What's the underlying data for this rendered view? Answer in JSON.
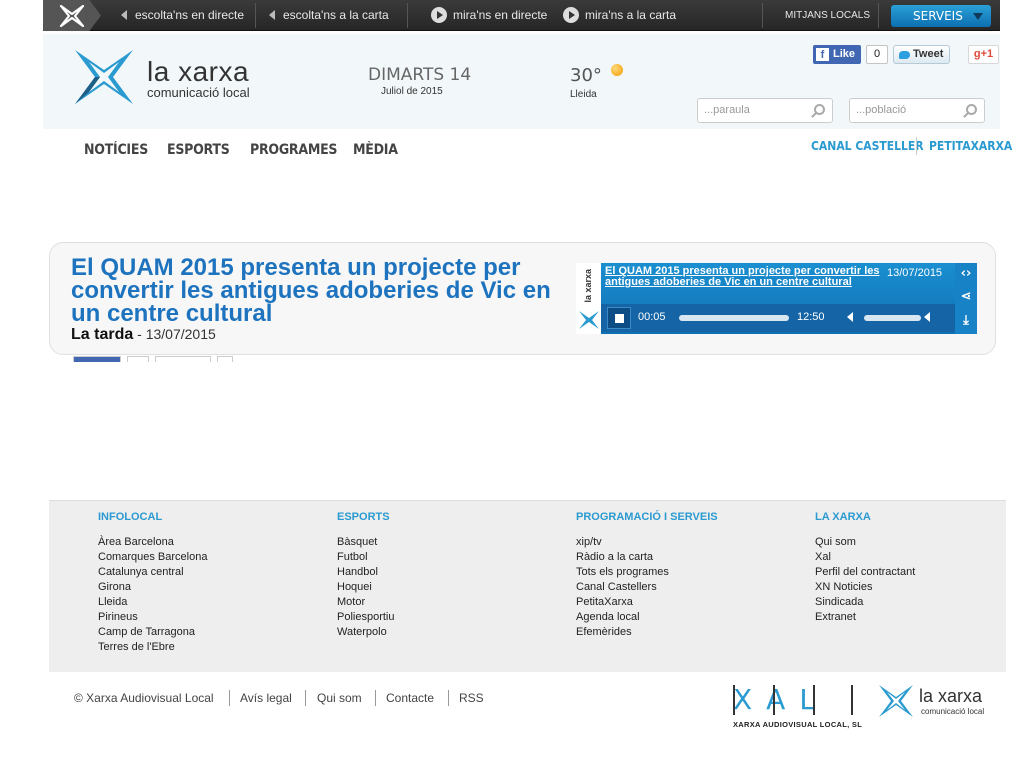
{
  "topbar": {
    "items": [
      {
        "label": "escolta'ns en directe",
        "icon": "speaker-icon"
      },
      {
        "label": "escolta'ns a la carta",
        "icon": "speaker-icon"
      },
      {
        "label": "mira'ns en directe",
        "icon": "play-icon"
      },
      {
        "label": "mira'ns a la carta",
        "icon": "play-icon"
      }
    ],
    "mitjans": "MITJANS LOCALS",
    "serveis": "SERVEIS"
  },
  "header": {
    "brand": "la xarxa",
    "brand_sub": "comunicació local",
    "date_day": "DIMARTS 14",
    "date_month": "Juliol de 2015",
    "temperature": "30°",
    "city": "Lleida",
    "like": "Like",
    "like_count": "0",
    "tweet": "Tweet",
    "gplus": "g+1",
    "search_word_placeholder": "...paraula",
    "search_town_placeholder": "...població"
  },
  "nav": {
    "items": [
      "NOTÍCIES",
      "ESPORTS",
      "PROGRAMES",
      "MÈDIA"
    ],
    "right": [
      "CANAL CASTELLER",
      "PETITAXARXA"
    ]
  },
  "article": {
    "title": "El QUAM 2015 presenta un projecte per convertir les antigues adoberies de Vic en un centre cultural",
    "program": "La tarda",
    "date": " - 13/07/2015",
    "player": {
      "side_label": "la xarxa",
      "title": "El QUAM 2015 presenta un projecte per convertir les antigues adoberies de Vic en un centre cultural",
      "date": "13/07/2015",
      "current": "00:05",
      "duration": "12:50",
      "progress": 0.01,
      "volume": 0.9
    }
  },
  "footer": {
    "columns": [
      {
        "heading": "INFOLOCAL",
        "links": [
          "Àrea Barcelona",
          "Comarques Barcelona",
          "Catalunya central",
          "Girona",
          "Lleida",
          "Pirineus",
          "Camp de Tarragona",
          "Terres de l'Ebre"
        ]
      },
      {
        "heading": "ESPORTS",
        "links": [
          "Bàsquet",
          "Futbol",
          "Handbol",
          "Hoquei",
          "Motor",
          "Poliesportiu",
          "Waterpolo"
        ]
      },
      {
        "heading": "PROGRAMACIÓ I SERVEIS",
        "links": [
          "xip/tv",
          "Ràdio a la carta",
          "Tots els programes",
          "Canal Castellers",
          "PetitaXarxa",
          "Agenda local",
          "Efemèrides"
        ]
      },
      {
        "heading": "LA XARXA",
        "links": [
          "Qui som",
          "Xal",
          "Perfil del contractant",
          "XN Noticies",
          "Sindicada",
          "Extranet"
        ]
      }
    ],
    "bottom_links": [
      "© Xarxa Audiovisual Local",
      "Avís legal",
      "Qui som",
      "Contacte",
      "RSS"
    ],
    "xal_letters": "XAL",
    "xal_sub": "XARXA AUDIOVISUAL LOCAL, SL",
    "brand": "la xarxa",
    "brand_sub": "comunicació local"
  },
  "colors": {
    "accent": "#2a9ad0",
    "title": "#1e73be",
    "player": "#1a8fd0"
  }
}
